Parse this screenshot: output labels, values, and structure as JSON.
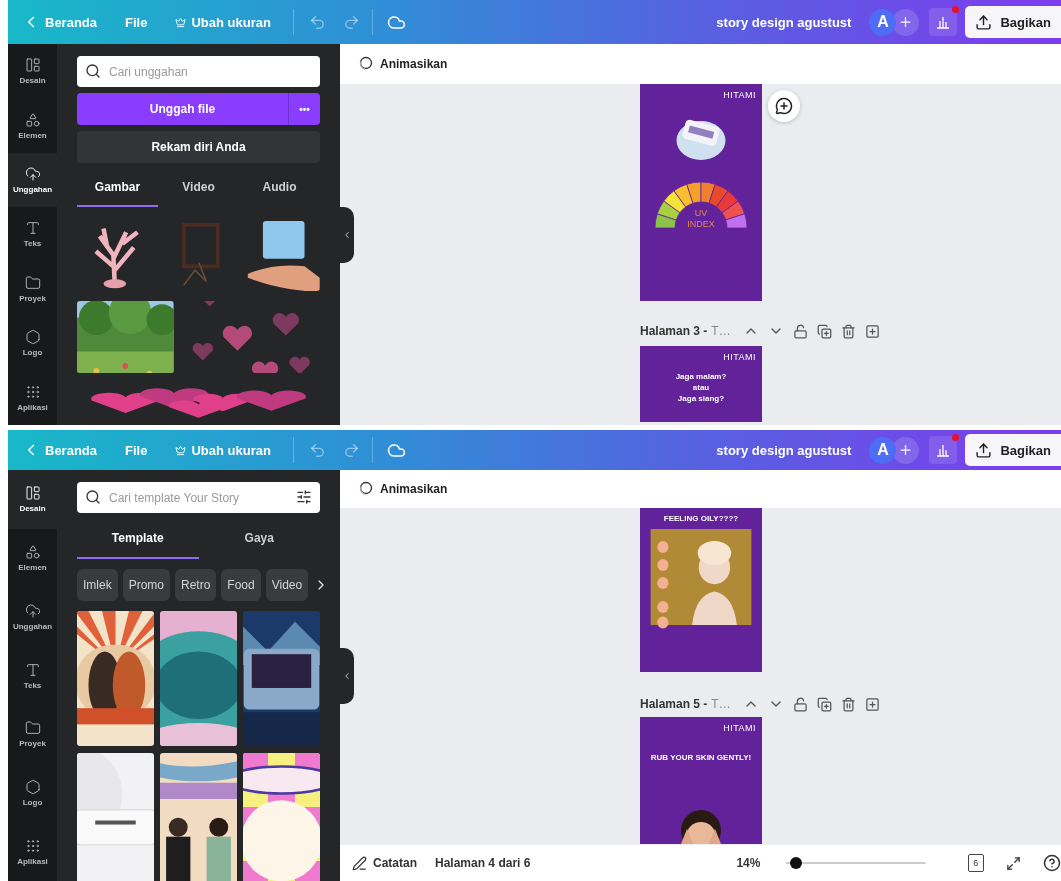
{
  "screens": [
    {
      "header": {
        "back": "Beranda",
        "file": "File",
        "resize": "Ubah ukuran",
        "title": "story design agustust",
        "avatar": "A",
        "share": "Bagikan",
        "notification": true
      },
      "nav": [
        {
          "label": "Desain",
          "selected": false
        },
        {
          "label": "Elemen",
          "selected": false
        },
        {
          "label": "Unggahan",
          "selected": true
        },
        {
          "label": "Teks",
          "selected": false
        },
        {
          "label": "Proyek",
          "selected": false
        },
        {
          "label": "Logo",
          "selected": false
        },
        {
          "label": "Aplikasi",
          "selected": false
        }
      ],
      "panel": {
        "kind": "uploads",
        "search": {
          "placeholder": "Cari unggahan"
        },
        "upload_button": "Unggah file",
        "more_button": "•••",
        "record_button": "Rekam diri Anda",
        "tabs": [
          {
            "label": "Gambar",
            "selected": true
          },
          {
            "label": "Video",
            "selected": false
          },
          {
            "label": "Audio",
            "selected": false
          }
        ],
        "items": [
          {
            "kind": "picture"
          },
          {
            "kind": "picture"
          },
          {
            "kind": "picture"
          },
          {
            "kind": "picture"
          },
          {
            "kind": "picture"
          },
          {
            "kind": "picture"
          }
        ]
      },
      "canvas": {
        "animate": "Animasikan",
        "comment_button": true,
        "items": [
          {
            "kind": "page",
            "content": [
              {
                "kind": "logo",
                "text": "HITAMI"
              },
              {
                "kind": "picture"
              },
              {
                "kind": "gauge",
                "texts": [
                  "UV",
                  "INDEX"
                ]
              }
            ]
          },
          {
            "kind": "page_header",
            "label": "Halaman 3 -",
            "title": "T…"
          },
          {
            "kind": "page",
            "content": [
              {
                "kind": "logo",
                "text": "HITAMI"
              },
              {
                "kind": "text",
                "text": "Jaga malam?\natau\nJaga siang?"
              }
            ]
          }
        ]
      }
    },
    {
      "header": {
        "back": "Beranda",
        "file": "File",
        "resize": "Ubah ukuran",
        "title": "story design agustust",
        "avatar": "A",
        "share": "Bagikan",
        "notification": true
      },
      "nav": [
        {
          "label": "Desain",
          "selected": true
        },
        {
          "label": "Elemen",
          "selected": false
        },
        {
          "label": "Unggahan",
          "selected": false
        },
        {
          "label": "Teks",
          "selected": false
        },
        {
          "label": "Proyek",
          "selected": false
        },
        {
          "label": "Logo",
          "selected": false
        },
        {
          "label": "Aplikasi",
          "selected": false
        }
      ],
      "panel": {
        "kind": "templates",
        "search": {
          "placeholder": "Cari template Your Story"
        },
        "tabs": [
          {
            "label": "Template",
            "selected": true
          },
          {
            "label": "Gaya",
            "selected": false
          }
        ],
        "chips": [
          "Imlek",
          "Promo",
          "Retro",
          "Food",
          "Video"
        ],
        "items": [
          {
            "kind": "picture"
          },
          {
            "kind": "picture"
          },
          {
            "kind": "picture"
          },
          {
            "kind": "picture"
          },
          {
            "kind": "picture"
          },
          {
            "kind": "picture"
          }
        ]
      },
      "canvas": {
        "animate": "Animasikan",
        "items": [
          {
            "kind": "page",
            "content": [
              {
                "kind": "heading",
                "text": "FEELING OILY????"
              },
              {
                "kind": "picture"
              }
            ]
          },
          {
            "kind": "page_header",
            "label": "Halaman 5 -",
            "title": "T…"
          },
          {
            "kind": "page",
            "content": [
              {
                "kind": "logo",
                "text": "HITAMI"
              },
              {
                "kind": "heading",
                "text": "RUB YOUR SKIN GENTLY!"
              },
              {
                "kind": "picture"
              }
            ]
          }
        ],
        "footer": {
          "notes": "Catatan",
          "page_info": "Halaman 4 dari 6",
          "zoom": "14%",
          "zoom_slider": {
            "level": 0.03
          },
          "page_count": "6"
        }
      }
    }
  ]
}
